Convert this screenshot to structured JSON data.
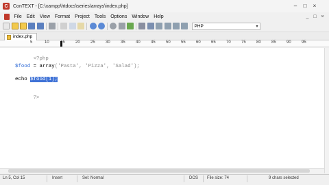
{
  "window": {
    "title": "ConTEXT - [C:\\xampp\\htdocs\\series\\arrays\\index.php]",
    "controls": [
      "–",
      "□",
      "×"
    ]
  },
  "menubar": {
    "items": [
      "File",
      "Edit",
      "View",
      "Format",
      "Project",
      "Tools",
      "Options",
      "Window",
      "Help"
    ],
    "doc_controls": [
      "_",
      "□",
      "×"
    ]
  },
  "toolbar": {
    "syntax_value": "PHP"
  },
  "tabs": [
    {
      "label": "index.php"
    }
  ],
  "ruler": {
    "numbers": [
      "5",
      "10",
      "15",
      "20",
      "25",
      "30",
      "35",
      "40",
      "45",
      "50",
      "55",
      "60",
      "65",
      "70",
      "75",
      "80",
      "85",
      "90",
      "95"
    ]
  },
  "editor": {
    "line1": "<?php",
    "line3_var": "$food",
    "line3_op": " = ",
    "line3_kw": "array",
    "line3_args": "('Pasta', 'Pizza', 'Salad');",
    "line5_kw": "echo ",
    "line5_sel": "$food[1];",
    "line7": "?>"
  },
  "statusbar": {
    "position": "Ln 5, Col 15",
    "mode": "Insert",
    "selection_mode": "Sel: Normal",
    "line_endings": "DOS",
    "file_size": "File size: 74",
    "selected": "9 chars selected"
  },
  "colors": {
    "selection": "#3f72d6",
    "variable": "#2e6ad6",
    "string": "#8a8a8a"
  }
}
